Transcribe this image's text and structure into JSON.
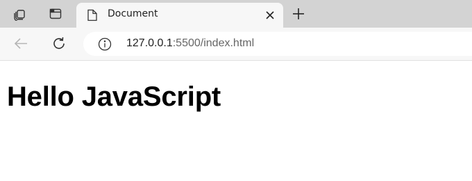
{
  "tabs": [
    {
      "title": "Document",
      "active": true
    }
  ],
  "address": {
    "host": "127.0.0.1",
    "path": ":5500/index.html"
  },
  "page": {
    "heading": "Hello JavaScript"
  },
  "icons": {
    "workspaces": "workspaces-icon",
    "tab_actions": "tab-actions-icon",
    "document": "document-icon",
    "close": "close-icon",
    "new_tab": "plus-icon",
    "back": "back-arrow-icon",
    "refresh": "refresh-icon",
    "info": "info-icon"
  },
  "colors": {
    "tabbar_bg": "#d3d3d3",
    "toolbar_bg": "#f7f7f7",
    "host_text": "#1f1f1f",
    "path_text": "#666666"
  }
}
